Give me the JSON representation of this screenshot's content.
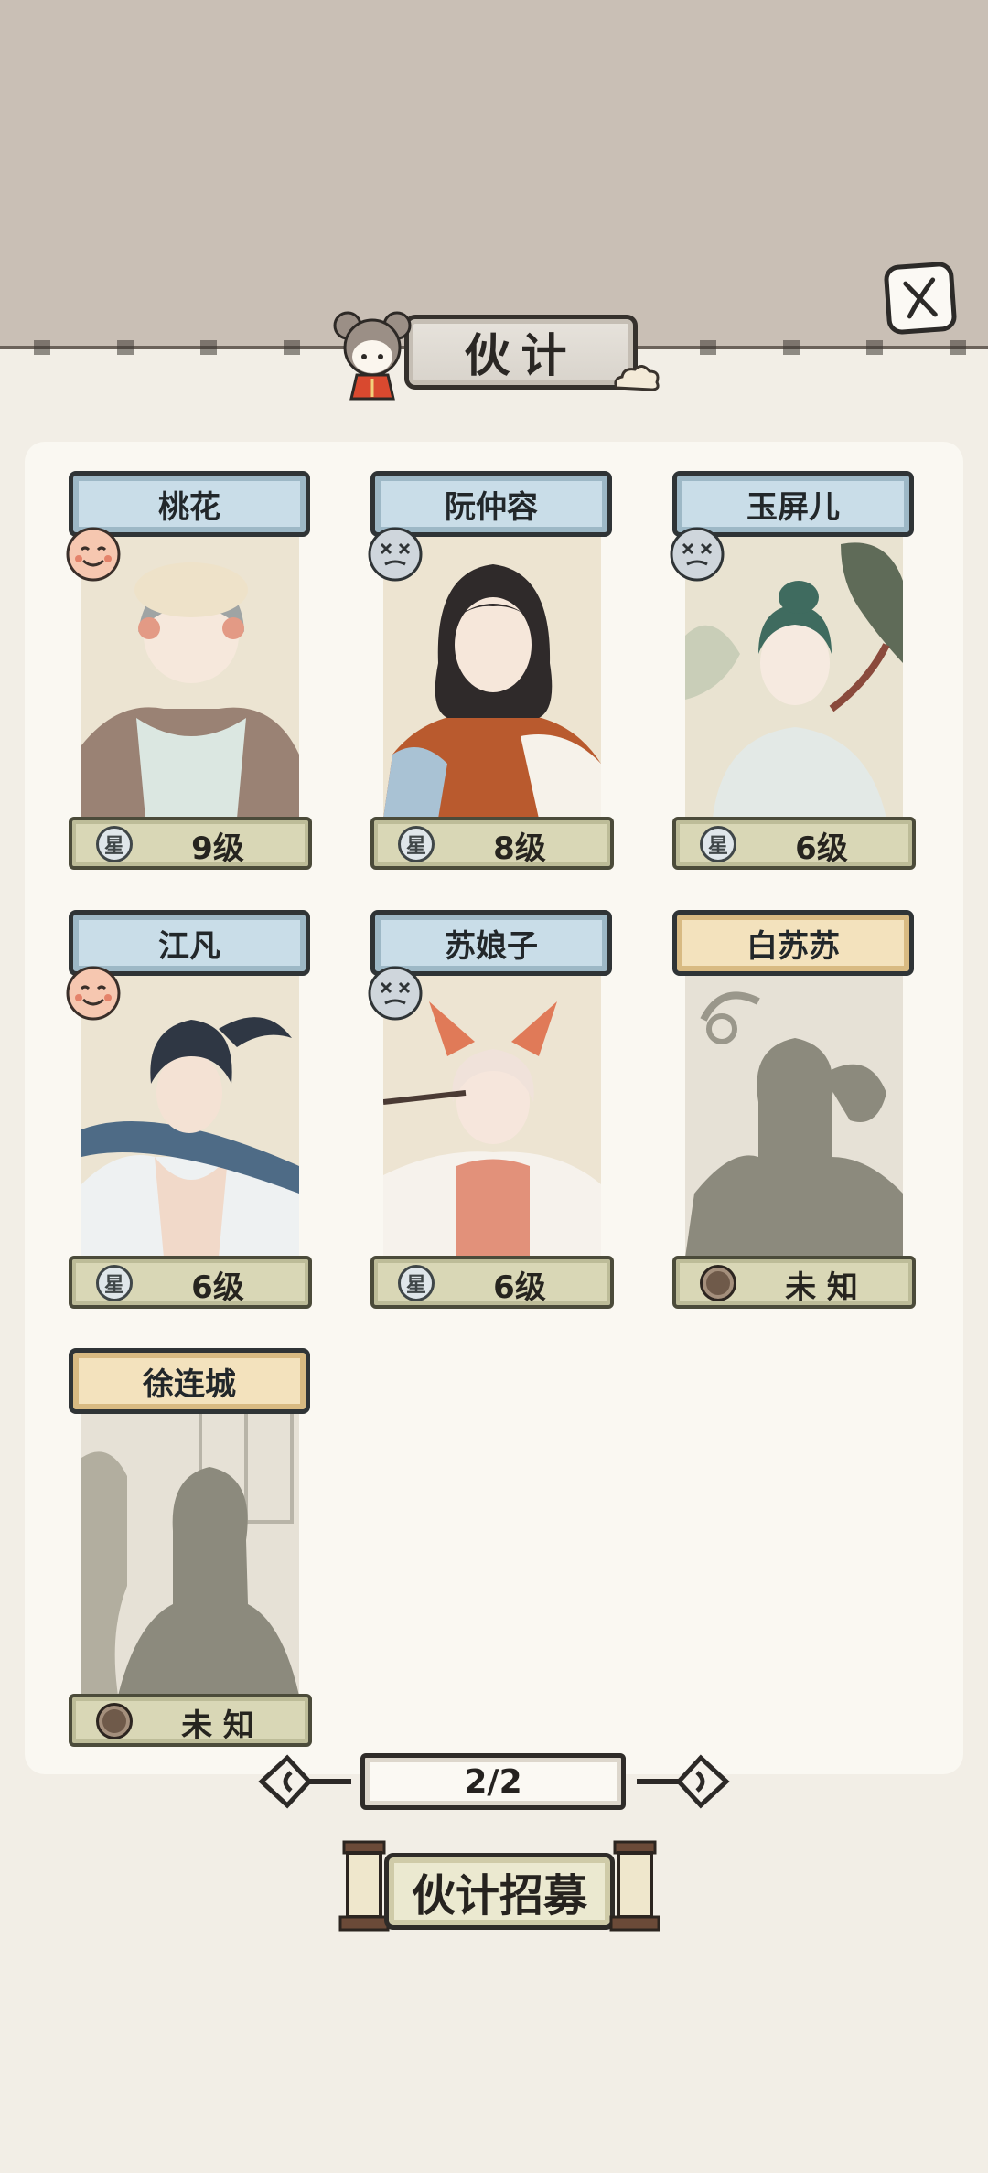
{
  "header": {
    "title": "伙计",
    "close_icon": "close-x-icon"
  },
  "characters": [
    {
      "name": "桃花",
      "level": "9级",
      "locked": false,
      "mood": "happy",
      "level_icon": "星"
    },
    {
      "name": "阮仲容",
      "level": "8级",
      "locked": false,
      "mood": "dizzy",
      "level_icon": "星"
    },
    {
      "name": "玉屏儿",
      "level": "6级",
      "locked": false,
      "mood": "dizzy",
      "level_icon": "星"
    },
    {
      "name": "江凡",
      "level": "6级",
      "locked": false,
      "mood": "happy",
      "level_icon": "星"
    },
    {
      "name": "苏娘子",
      "level": "6级",
      "locked": false,
      "mood": "dizzy",
      "level_icon": "星"
    },
    {
      "name": "白苏苏",
      "level": "未 知",
      "locked": true,
      "mood": null,
      "level_icon": ""
    },
    {
      "name": "徐连城",
      "level": "未 知",
      "locked": true,
      "mood": null,
      "level_icon": ""
    }
  ],
  "pagination": {
    "label": "2/2",
    "prev_icon": "prev-arrow-icon",
    "next_icon": "next-arrow-icon"
  },
  "recruit": {
    "label": "伙计招募"
  },
  "colors": {
    "top_band": "#c9bfb5",
    "background": "#f2eee6",
    "panel": "#faf8f2",
    "name_plate_blue": "#c9dde8",
    "name_plate_gold": "#f3e2bd",
    "level_bar": "#d9d7b6"
  }
}
